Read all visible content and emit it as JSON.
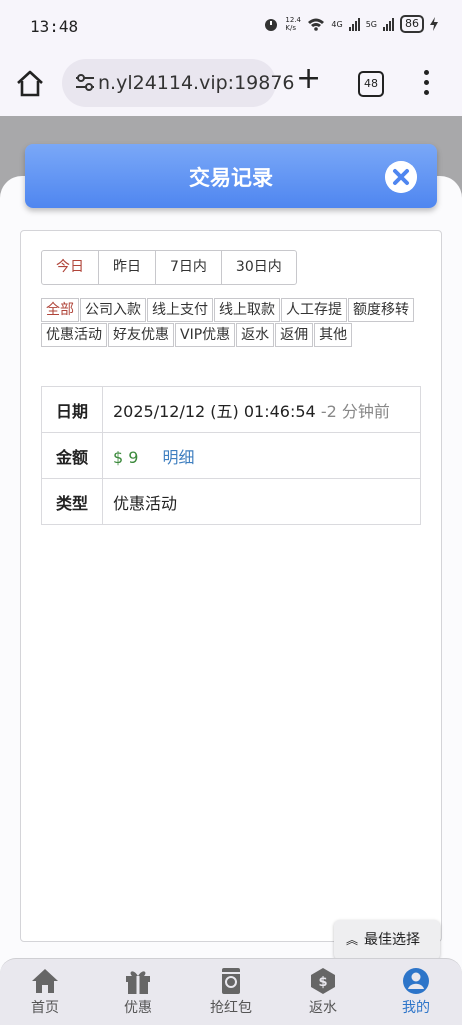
{
  "status_bar": {
    "time": "13:48",
    "speed": "12.4 K/s",
    "net1": "4G",
    "net2": "5G",
    "battery": "86"
  },
  "browser": {
    "url": "n.yl24114.vip:19876",
    "tab_count": "48"
  },
  "header": {
    "title": "交易记录"
  },
  "date_tabs": [
    "今日",
    "昨日",
    "7日内",
    "30日内"
  ],
  "date_tab_active": 0,
  "type_filters": [
    "全部",
    "公司入款",
    "线上支付",
    "线上取款",
    "人工存提",
    "额度移转",
    "优惠活动",
    "好友优惠",
    "VIP优惠",
    "返水",
    "返佣",
    "其他"
  ],
  "type_filter_active": 0,
  "record": {
    "date_label": "日期",
    "date_value": "2025/12/12 (五) 01:46:54",
    "date_ago": "-2 分钟前",
    "amount_label": "金额",
    "amount_value": "$ 9",
    "detail_link": "明细",
    "type_label": "类型",
    "type_value": "优惠活动"
  },
  "best_choice": "最佳选择",
  "bottom_nav": [
    {
      "label": "首页",
      "icon": "home-icon"
    },
    {
      "label": "优惠",
      "icon": "gift-icon"
    },
    {
      "label": "抢红包",
      "icon": "red-envelope-icon"
    },
    {
      "label": "返水",
      "icon": "dollar-coin-icon"
    },
    {
      "label": "我的",
      "icon": "user-icon"
    }
  ],
  "bottom_nav_active": 4,
  "colors": {
    "header_blue": "#4f86f0",
    "active_red": "#b0453a",
    "amount_green": "#3c8a3c",
    "link_blue": "#3f7fc0",
    "nav_active": "#2d75c9"
  }
}
